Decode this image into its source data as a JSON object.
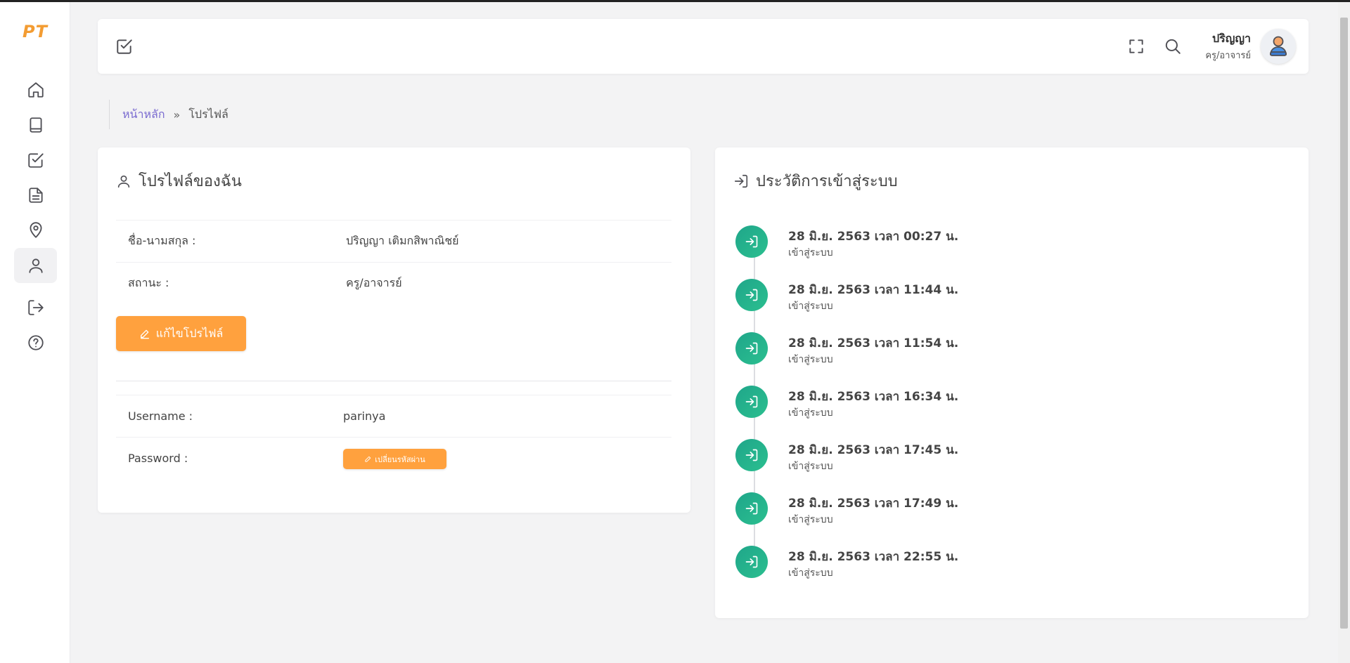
{
  "brand": {
    "logo": "PT",
    "accent": "#ffa13e"
  },
  "sidebar": {
    "items": [
      {
        "icon": "home-icon"
      },
      {
        "icon": "book-icon"
      },
      {
        "icon": "checkbox-icon"
      },
      {
        "icon": "document-icon"
      },
      {
        "icon": "map-pin-icon"
      },
      {
        "icon": "user-icon",
        "active": true
      },
      {
        "icon": "logout-icon"
      },
      {
        "icon": "help-icon"
      }
    ]
  },
  "header": {
    "page_icon": "checkbox-icon",
    "user_name": "ปริญญา",
    "user_role": "ครู/อาจารย์"
  },
  "breadcrumb": {
    "home": "หน้าหลัก",
    "current": "โปรไฟล์"
  },
  "profile": {
    "title": "โปรไฟล์ของฉัน",
    "fullname_label": "ชื่อ-นามสกุล :",
    "fullname_value": "ปริญญา เติมกสิพาณิชย์",
    "status_label": "สถานะ :",
    "status_value": "ครู/อาจารย์",
    "edit_button": "แก้ไขโปรไฟล์",
    "username_label": "Username :",
    "username_value": "parinya",
    "password_label": "Password :",
    "change_password_button": "เปลี่ยนรหัสผ่าน"
  },
  "login_history": {
    "title": "ประวัติการเข้าสู่ระบบ",
    "items": [
      {
        "time": "28 มิ.ย. 2563 เวลา 00:27 น.",
        "status": "เข้าสู่ระบบ"
      },
      {
        "time": "28 มิ.ย. 2563 เวลา 11:44 น.",
        "status": "เข้าสู่ระบบ"
      },
      {
        "time": "28 มิ.ย. 2563 เวลา 11:54 น.",
        "status": "เข้าสู่ระบบ"
      },
      {
        "time": "28 มิ.ย. 2563 เวลา 16:34 น.",
        "status": "เข้าสู่ระบบ"
      },
      {
        "time": "28 มิ.ย. 2563 เวลา 17:45 น.",
        "status": "เข้าสู่ระบบ"
      },
      {
        "time": "28 มิ.ย. 2563 เวลา 17:49 น.",
        "status": "เข้าสู่ระบบ"
      },
      {
        "time": "28 มิ.ย. 2563 เวลา 22:55 น.",
        "status": "เข้าสู่ระบบ"
      }
    ]
  }
}
